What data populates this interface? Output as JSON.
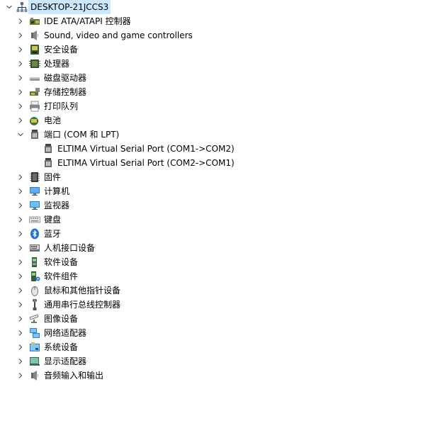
{
  "root": {
    "label": "DESKTOP-21JCCS3",
    "icon": "computer-tree-icon",
    "expanded": true
  },
  "categories": [
    {
      "label": "IDE ATA/ATAPI 控制器",
      "icon": "ide-controller-icon",
      "expanded": false
    },
    {
      "label": "Sound, video and game controllers",
      "icon": "speaker-icon",
      "expanded": false
    },
    {
      "label": "安全设备",
      "icon": "security-device-icon",
      "expanded": false
    },
    {
      "label": "处理器",
      "icon": "processor-icon",
      "expanded": false
    },
    {
      "label": "磁盘驱动器",
      "icon": "disk-drive-icon",
      "expanded": false
    },
    {
      "label": "存储控制器",
      "icon": "storage-controller-icon",
      "expanded": false
    },
    {
      "label": "打印队列",
      "icon": "printer-icon",
      "expanded": false
    },
    {
      "label": "电池",
      "icon": "battery-icon",
      "expanded": false
    },
    {
      "label": "端口 (COM 和 LPT)",
      "icon": "port-icon",
      "expanded": true,
      "children": [
        {
          "label": "ELTIMA Virtual Serial Port (COM1->COM2)",
          "icon": "port-icon"
        },
        {
          "label": "ELTIMA Virtual Serial Port (COM2->COM1)",
          "icon": "port-icon"
        }
      ]
    },
    {
      "label": "固件",
      "icon": "firmware-icon",
      "expanded": false
    },
    {
      "label": "计算机",
      "icon": "computer-icon",
      "expanded": false
    },
    {
      "label": "监视器",
      "icon": "monitor-icon",
      "expanded": false
    },
    {
      "label": "键盘",
      "icon": "keyboard-icon",
      "expanded": false
    },
    {
      "label": "蓝牙",
      "icon": "bluetooth-icon",
      "expanded": false
    },
    {
      "label": "人机接口设备",
      "icon": "hid-icon",
      "expanded": false
    },
    {
      "label": "软件设备",
      "icon": "software-device-icon",
      "expanded": false
    },
    {
      "label": "软件组件",
      "icon": "software-component-icon",
      "expanded": false
    },
    {
      "label": "鼠标和其他指针设备",
      "icon": "mouse-icon",
      "expanded": false
    },
    {
      "label": "通用串行总线控制器",
      "icon": "usb-icon",
      "expanded": false
    },
    {
      "label": "图像设备",
      "icon": "camera-icon",
      "expanded": false
    },
    {
      "label": "网络适配器",
      "icon": "network-adapter-icon",
      "expanded": false
    },
    {
      "label": "系统设备",
      "icon": "system-device-icon",
      "expanded": false
    },
    {
      "label": "显示适配器",
      "icon": "display-adapter-icon",
      "expanded": false
    },
    {
      "label": "音频输入和输出",
      "icon": "audio-io-icon",
      "expanded": false
    }
  ],
  "colors": {
    "selection": "#cce8ff",
    "chevron": "#555555"
  }
}
